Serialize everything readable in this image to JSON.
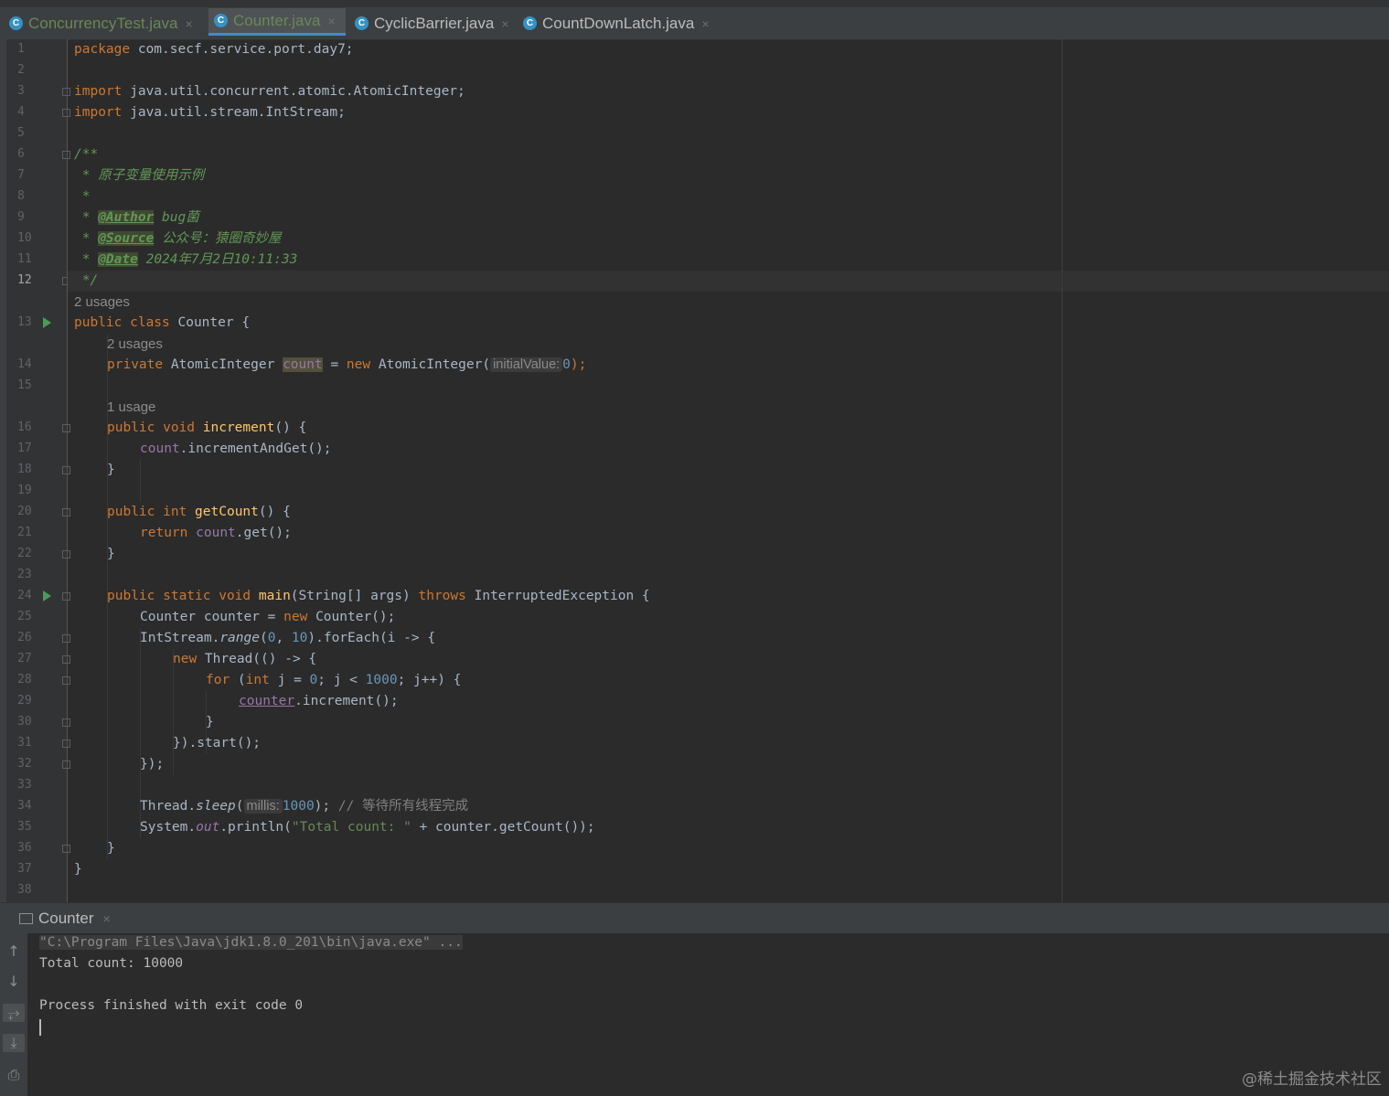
{
  "tabs": [
    {
      "label": "ConcurrencyTest.java",
      "active": false,
      "modified": true
    },
    {
      "label": "Counter.java",
      "active": true,
      "modified": true
    },
    {
      "label": "CyclicBarrier.java",
      "active": false,
      "modified": false
    },
    {
      "label": "CountDownLatch.java",
      "active": false,
      "modified": false
    }
  ],
  "tab_icon_letter": "C",
  "close_glyph": "×",
  "gutter": {
    "line_numbers": [
      "1",
      "2",
      "3",
      "4",
      "5",
      "6",
      "7",
      "8",
      "9",
      "10",
      "11",
      "12",
      "13",
      "14",
      "15",
      "16",
      "17",
      "18",
      "19",
      "20",
      "21",
      "22",
      "23",
      "24",
      "25",
      "26",
      "27",
      "28",
      "29",
      "30",
      "31",
      "32",
      "33",
      "34",
      "35",
      "36",
      "37",
      "38"
    ],
    "current_line": "12"
  },
  "code": {
    "l1_kw": "package",
    "l1_rest": " com.secf.service.port.day7;",
    "l3_kw": "import",
    "l3_rest": " java.util.concurrent.atomic.AtomicInteger;",
    "l4_kw": "import",
    "l4_rest": " java.util.stream.IntStream;",
    "l6": "/**",
    "l7": " * 原子变量使用示例",
    "l8": " *",
    "l9_pre": " * ",
    "l9_tag": "@Author",
    "l9_val": " bug菌",
    "l10_pre": " * ",
    "l10_tag": "@Source",
    "l10_val": " 公众号：猿圈奇妙屋",
    "l11_pre": " * ",
    "l11_tag": "@Date",
    "l11_val": " 2024年7月2日10:11:33",
    "l12": " */",
    "usage_class": "2 usages",
    "l13_kw": "public class",
    "l13_rest": " Counter {",
    "usage_field": "2 usages",
    "l14_kw": "private",
    "l14_type": " AtomicInteger ",
    "l14_field": "count",
    "l14_eq": " = ",
    "l14_new": "new",
    "l14_ctor": " AtomicInteger(",
    "l14_hint": "initialValue:",
    "l14_num": "0",
    "l14_end": ");",
    "usage_inc": "1 usage",
    "l16_kw": "public void",
    "l16_m": "increment",
    "l16_rest": "() {",
    "l17_field": "count",
    "l17_rest": ".incrementAndGet();",
    "l18": "}",
    "l20_kw": "public int",
    "l20_m": "getCount",
    "l20_rest": "() {",
    "l21_kw": "return",
    "l21_field": "count",
    "l21_rest": ".get();",
    "l22": "}",
    "l24_kw": "public static void",
    "l24_m": "main",
    "l24_args": "(String[] args) ",
    "l24_throws": "throws",
    "l24_rest": " InterruptedException {",
    "l25_a": "Counter counter = ",
    "l25_new": "new",
    "l25_b": " Counter();",
    "l26_a": "IntStream.",
    "l26_m": "range",
    "l26_b": "(",
    "l26_n1": "0",
    "l26_c": ", ",
    "l26_n2": "10",
    "l26_d": ").forEach(i -> {",
    "l27_new": "new",
    "l27_rest": " Thread(() -> {",
    "l28_for": "for",
    "l28_a": " (",
    "l28_int": "int",
    "l28_b": " j = ",
    "l28_n0": "0",
    "l28_c": "; j < ",
    "l28_n1000": "1000",
    "l28_d": "; j++) {",
    "l29_var": "counter",
    "l29_rest": ".increment();",
    "l30": "}",
    "l31": "}).start();",
    "l32": "});",
    "l34_a": "Thread.",
    "l34_m": "sleep",
    "l34_b": "(",
    "l34_hint": "millis:",
    "l34_num": "1000",
    "l34_c": "); ",
    "l34_comment": "// 等待所有线程完成",
    "l35_a": "System.",
    "l35_out": "out",
    "l35_b": ".println(",
    "l35_str": "\"Total count: \"",
    "l35_c": " + counter.getCount());",
    "l36": "}",
    "l37": "}"
  },
  "run_panel": {
    "tab_label": "Counter",
    "command": "\"C:\\Program Files\\Java\\jdk1.8.0_201\\bin\\java.exe\" ...",
    "output_line": "Total count: 10000",
    "exit_line": "Process finished with exit code 0"
  },
  "watermark": "@稀土掘金技术社区",
  "colors": {
    "keyword": "#cc7832",
    "string": "#6a8759",
    "number": "#6897bb",
    "field": "#9876aa",
    "method": "#ffc66d",
    "comment": "#629755",
    "accent": "#4a88c7"
  }
}
